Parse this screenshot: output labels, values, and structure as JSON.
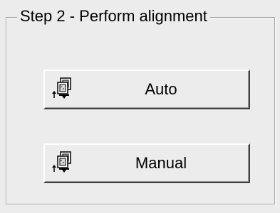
{
  "group": {
    "title": "Step 2 - Perform alignment"
  },
  "buttons": {
    "auto_label": "Auto",
    "manual_label": "Manual"
  },
  "icons": {
    "alignment": "align-pages-icon"
  }
}
